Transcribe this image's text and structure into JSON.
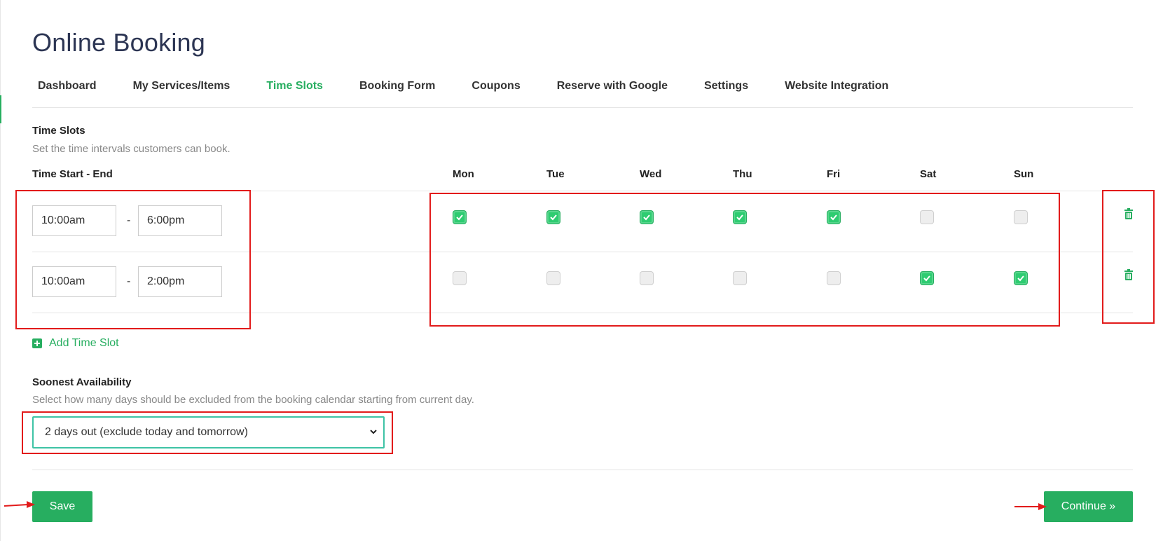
{
  "page": {
    "title": "Online Booking"
  },
  "nav": {
    "items": [
      {
        "label": "Dashboard",
        "active": false
      },
      {
        "label": "My Services/Items",
        "active": false
      },
      {
        "label": "Time Slots",
        "active": true
      },
      {
        "label": "Booking Form",
        "active": false
      },
      {
        "label": "Coupons",
        "active": false
      },
      {
        "label": "Reserve with Google",
        "active": false
      },
      {
        "label": "Settings",
        "active": false
      },
      {
        "label": "Website Integration",
        "active": false
      }
    ]
  },
  "time_slots": {
    "title": "Time Slots",
    "description": "Set the time intervals customers can book.",
    "time_header": "Time Start - End",
    "separator": "-",
    "days": [
      "Mon",
      "Tue",
      "Wed",
      "Thu",
      "Fri",
      "Sat",
      "Sun"
    ],
    "rows": [
      {
        "start": "10:00am",
        "end": "6:00pm",
        "checked": [
          true,
          true,
          true,
          true,
          true,
          false,
          false
        ]
      },
      {
        "start": "10:00am",
        "end": "2:00pm",
        "checked": [
          false,
          false,
          false,
          false,
          false,
          true,
          true
        ]
      }
    ],
    "add_label": "Add Time Slot"
  },
  "soonest": {
    "title": "Soonest Availability",
    "description": "Select how many days should be excluded from the booking calendar starting from current day.",
    "selected": "2 days out (exclude today and tomorrow)"
  },
  "actions": {
    "save": "Save",
    "continue": "Continue »"
  },
  "colors": {
    "accent": "#27ae60",
    "annotation": "#e21b1b",
    "title": "#2c3553"
  },
  "icons": [
    "check-icon",
    "trash-icon",
    "plus-icon",
    "chevron-down-icon",
    "arrow-right-icon"
  ]
}
